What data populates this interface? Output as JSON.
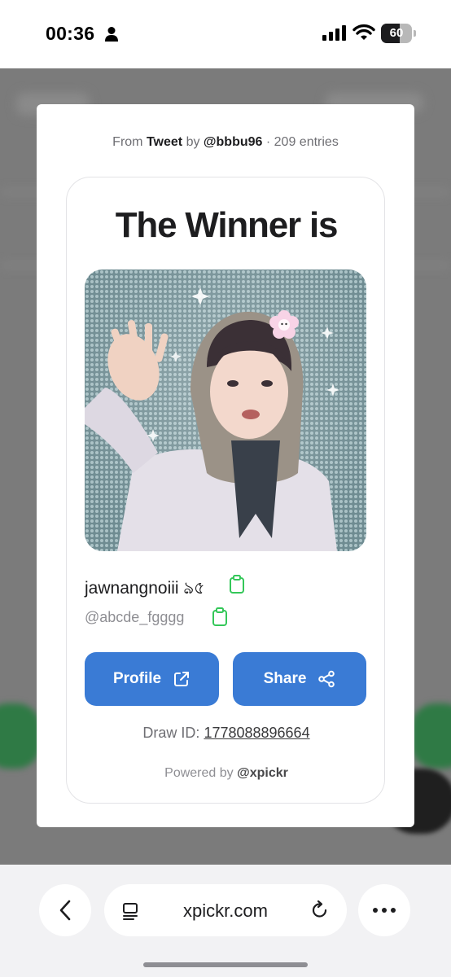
{
  "status_bar": {
    "time": "00:36",
    "battery": "60",
    "battery_level_percent": 60
  },
  "modal": {
    "source": {
      "prefix": "From",
      "type": "Tweet",
      "by": "by",
      "author": "@bbbu96",
      "entries": "· 209 entries"
    },
    "title": "The Winner is",
    "winner": {
      "name": "jawnangnoiii ঌ৫",
      "handle": "@abcde_fgggg"
    },
    "buttons": {
      "profile": "Profile",
      "share": "Share"
    },
    "draw_id_label": "Draw ID:",
    "draw_id": "1778088896664",
    "powered_by": "Powered by",
    "powered_brand": "@xpickr"
  },
  "browser": {
    "url": "xpickr.com"
  },
  "colors": {
    "primary_button": "#3a7bd5",
    "copy_icon": "#34c759",
    "backdrop": "#7b7b7b"
  },
  "icons": [
    "person-icon",
    "signal-icon",
    "wifi-icon",
    "battery-icon",
    "copy-icon",
    "external-link-icon",
    "share-icon",
    "back-icon",
    "reader-icon",
    "reload-icon",
    "more-icon"
  ]
}
